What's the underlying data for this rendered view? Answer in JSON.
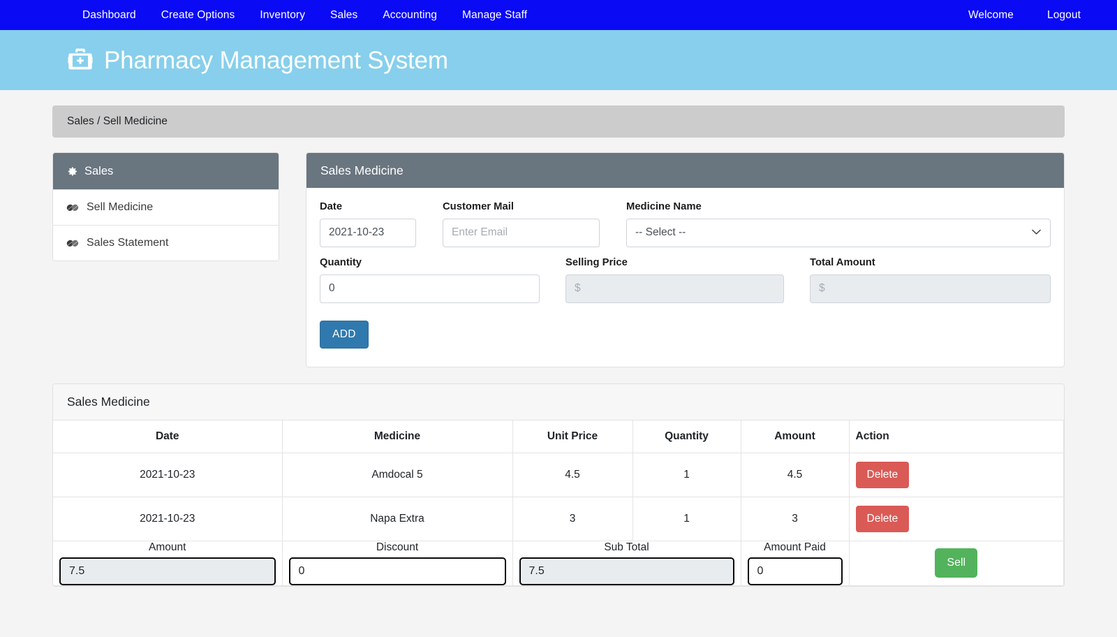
{
  "navbar": {
    "brand_color": "#0a0af5",
    "left_items": [
      {
        "label": "Dashboard",
        "name": "dashboard"
      },
      {
        "label": "Create Options",
        "name": "create-options"
      },
      {
        "label": "Inventory",
        "name": "inventory"
      },
      {
        "label": "Sales",
        "name": "sales"
      },
      {
        "label": "Accounting",
        "name": "accounting"
      },
      {
        "label": "Manage Staff",
        "name": "manage-staff"
      }
    ],
    "right_items": [
      {
        "label": "Welcome",
        "name": "welcome"
      },
      {
        "label": "Logout",
        "name": "logout"
      }
    ]
  },
  "banner": {
    "title": "Pharmacy Management System",
    "icon": "medical-kit-icon",
    "background": "#87cfec"
  },
  "breadcrumb": {
    "text": "Sales / Sell Medicine"
  },
  "sidebar": {
    "header": "Sales",
    "header_icon": "gear-icon",
    "items": [
      {
        "label": "Sell Medicine",
        "icon": "capsules-icon"
      },
      {
        "label": "Sales Statement",
        "icon": "capsules-icon"
      }
    ]
  },
  "form": {
    "title": "Sales Medicine",
    "date_label": "Date",
    "date_value": "2021-10-23",
    "mail_label": "Customer Mail",
    "mail_value": "",
    "mail_placeholder": "Enter Email",
    "medicine_label": "Medicine Name",
    "medicine_value": "-- Select --",
    "quantity_label": "Quantity",
    "quantity_value": "0",
    "selling_price_label": "Selling Price",
    "selling_price_value": "",
    "selling_price_placeholder": "$",
    "total_amount_label": "Total Amount",
    "total_amount_value": "",
    "total_amount_placeholder": "$",
    "add_button": "ADD"
  },
  "table": {
    "title": "Sales Medicine",
    "columns": [
      "Date",
      "Medicine",
      "Unit Price",
      "Quantity",
      "Amount",
      "Action"
    ],
    "rows": [
      {
        "date": "2021-10-23",
        "medicine": "Amdocal 5",
        "unit_price": "4.5",
        "quantity": "1",
        "amount": "4.5",
        "action": "Delete"
      },
      {
        "date": "2021-10-23",
        "medicine": "Napa Extra",
        "unit_price": "3",
        "quantity": "1",
        "amount": "3",
        "action": "Delete"
      }
    ],
    "footer": {
      "amount_label": "Amount",
      "amount_value": "7.5",
      "discount_label": "Discount",
      "discount_value": "0",
      "subtotal_label": "Sub Total",
      "subtotal_value": "7.5",
      "amount_paid_label": "Amount Paid",
      "amount_paid_value": "0",
      "sell_button": "Sell"
    }
  },
  "colors": {
    "navbar": "#0a0af5",
    "banner": "#87cfec",
    "panel_header": "#69757f",
    "breadcrumb": "#cccccc",
    "primary_button": "#3079ae",
    "danger_button": "#da5a56",
    "success_button": "#52b35c"
  }
}
